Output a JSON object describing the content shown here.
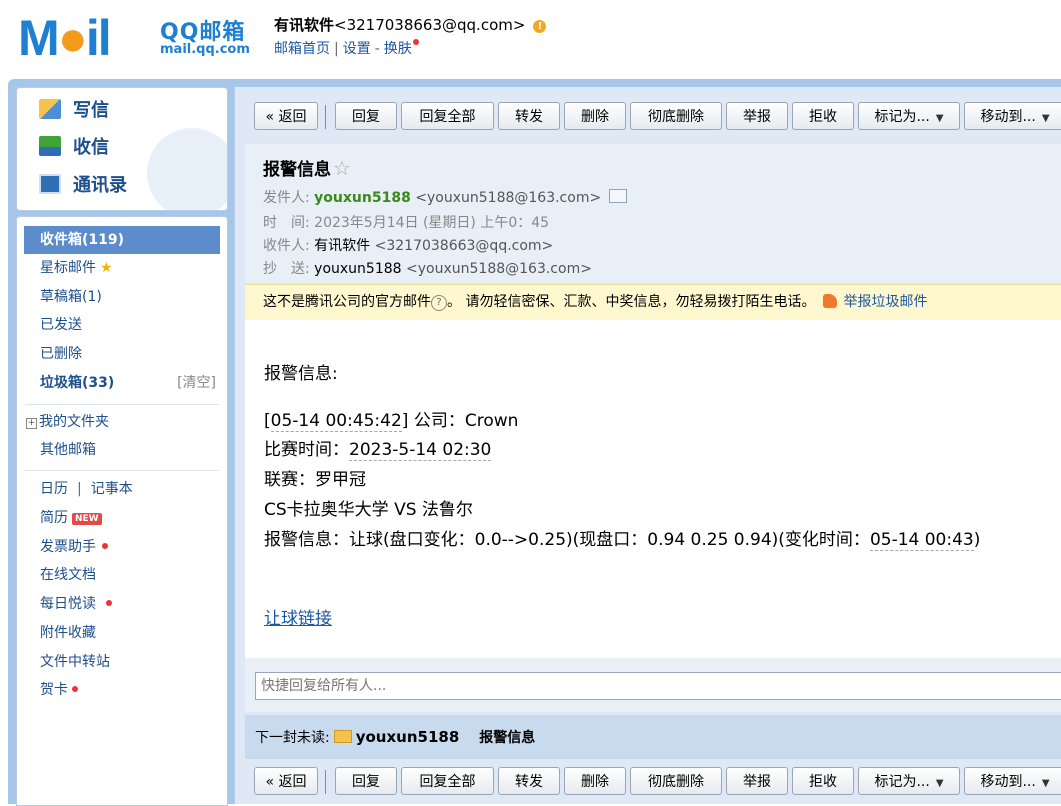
{
  "logo": {
    "mail_text": "Mail",
    "product": "QQ邮箱",
    "url": "mail.qq.com"
  },
  "header": {
    "user_name": "有讯软件",
    "user_email": "<3217038663@qq.com>",
    "warning_glyph": "!",
    "links": {
      "home": "邮箱首页",
      "sep": "|",
      "settings": "设置",
      "dash": "-",
      "skin": "换肤"
    }
  },
  "quick": [
    {
      "label": "写信",
      "icon": "pencil-icon"
    },
    {
      "label": "收信",
      "icon": "download-icon"
    },
    {
      "label": "通讯录",
      "icon": "contacts-icon"
    }
  ],
  "folders": {
    "inbox": "收件箱(119)",
    "starred": "星标邮件",
    "drafts": "草稿箱(1)",
    "sent": "已发送",
    "deleted": "已删除",
    "spam": "垃圾箱(33)",
    "spam_clear": "[清空]",
    "my_folders": "我的文件夹",
    "other_mailbox": "其他邮箱",
    "calendar": "日历",
    "sep": "|",
    "notes": "记事本",
    "resume": "简历",
    "new_badge": "NEW",
    "invoice": "发票助手",
    "docs": "在线文档",
    "reading": "每日悦读",
    "attachments": "附件收藏",
    "transfer": "文件中转站",
    "cards": "贺卡"
  },
  "toolbar": {
    "back": "« 返回",
    "reply": "回复",
    "reply_all": "回复全部",
    "forward": "转发",
    "delete": "删除",
    "delete_forever": "彻底删除",
    "report": "举报",
    "reject": "拒收",
    "mark_as": "标记为...",
    "move_to": "移动到...",
    "caret": "▼"
  },
  "mail": {
    "subject": "报警信息",
    "star": "☆",
    "from_label": "发件人:",
    "from_name": "youxun5188",
    "from_addr": "<youxun5188@163.com>",
    "time_label": "时　间:",
    "time_value": "2023年5月14日 (星期日) 上午0：45",
    "to_label": "收件人:",
    "to_name": "有讯软件",
    "to_addr": "<3217038663@qq.com>",
    "cc_label": "抄　送:",
    "cc_name": "youxun5188",
    "cc_addr": "<youxun5188@163.com>"
  },
  "notice": {
    "text1": "这不是腾讯公司的官方邮件",
    "q": "?",
    "text2": "。 请勿轻信密保、汇款、中奖信息，勿轻易拨打陌生电话。",
    "report": "举报垃圾邮件"
  },
  "body": {
    "line1": "报警信息:",
    "line2a": "[",
    "line2_time": "05-14 00:45:42",
    "line2b": "] 公司：Crown",
    "line3a": "比赛时间：",
    "line3_time": "2023-5-14 02:30",
    "line4": "联赛：罗甲冠",
    "line5": "CS卡拉奥华大学 VS 法鲁尔",
    "line6a": "报警信息：让球(盘口变化：0.0-->0.25)(现盘口：0.94 0.25 0.94)(变化时间：",
    "line6_time": "05-14 00:43",
    "line6b": ")",
    "link": "让球链接"
  },
  "reply": {
    "placeholder": "快捷回复给所有人..."
  },
  "next": {
    "label": "下一封未读:",
    "sender": "youxun5188",
    "subject": "报警信息"
  },
  "colors": {
    "accent": "#1f7fd1",
    "sidebar_active": "#5d8ccd",
    "frame": "#a6c7ea",
    "sender_green": "#3a8a18",
    "notice_bg": "#fff8cf"
  }
}
